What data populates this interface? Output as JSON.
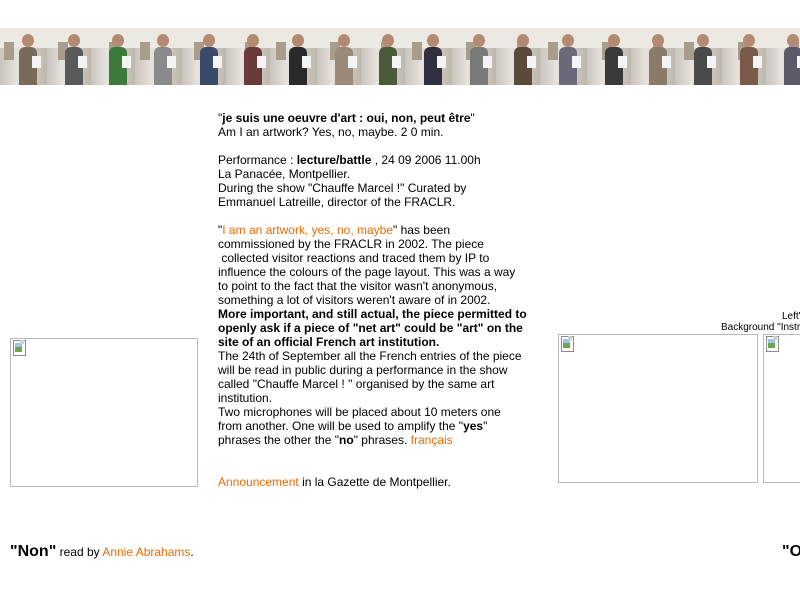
{
  "banner": {
    "frames": 18
  },
  "main": {
    "title_quote_open": "\"",
    "title_bold": "je suis une oeuvre d'art : oui, non, peut être",
    "title_quote_close": "\"",
    "subtitle": "Am I an artwork? Yes, no, maybe. 2 0 min.",
    "perf_prefix": "Performance : ",
    "perf_bold": "lecture/battle",
    "perf_rest": " , 24 09 2006 11.00h",
    "venue": "La Panacée, Montpellier.",
    "during": "During the show \"Chauffe Marcel !\" Curated by",
    "curator": "Emmanuel Latreille, director of the FRACLR.",
    "p2_quote_open": "\"",
    "p2_link": "I am an artwork, yes, no, maybe",
    "p2_after_link": "\" has been",
    "p2_l2": "commissioned by the FRACLR in 2002. The piece",
    "p2_l3": " collected visitor reactions and traced them by IP to",
    "p2_l4": "influence the colours of the page layout. This was a way",
    "p2_l5": "to point to the fact that the visitor wasn't anonymous,",
    "p2_l6": "something a lot of visitors weren't aware of in 2002.",
    "p3_bold_1": "More important, and still actual, the piece permitted to",
    "p3_bold_2": "openly ask if a piece of \"net art\" could be \"art\" on the",
    "p3_bold_3": "site of an official French art institution.",
    "p4_l1": "The 24th of September all the French entries of the piece",
    "p4_l2": "will be read in public during a performance in the show",
    "p4_l3": "called \"Chauffe Marcel ! \" organised by the same art",
    "p4_l4": "institution.",
    "p5_l1": "Two microphones will be placed about 10 meters one",
    "p5_l2_a": "from another. One will be used to amplify the \"",
    "p5_l2_b": "yes",
    "p5_l2_c": "\"",
    "p5_l3_a": "phrases the other the \"",
    "p5_l3_b": "no",
    "p5_l3_c": "\" phrases. ",
    "p5_link": "français",
    "announce_link": "Announcement",
    "announce_rest": " in la Gazette de Montpellier."
  },
  "left_caption": {
    "quote_open": "\"",
    "word": "Non",
    "quote_close": "\"",
    "read_by": " read by ",
    "reader": "Annie Abrahams",
    "period": "."
  },
  "right_area": {
    "clipped_label_1": "Left'",
    "clipped_label_2": "Background \"Instr",
    "clipped_caption": "\"O"
  },
  "colors": {
    "link": "#ee6a00",
    "image_border": "#b8b8b8"
  }
}
